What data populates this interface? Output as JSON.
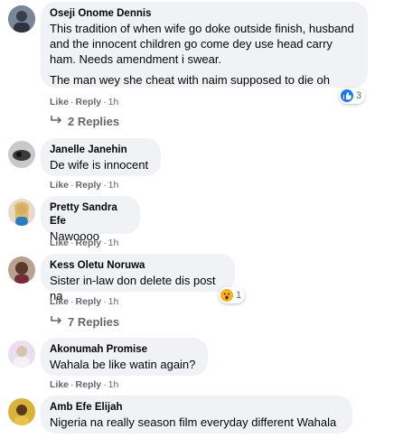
{
  "comments": [
    {
      "name": "Oseji Onome Dennis",
      "text1": "This tradition of when wife go doke outside finish, husband and the innocent children go come dey use head carry ham. Needs amendment i swear.",
      "text2": "The man wey she cheat with naim supposed to die oh",
      "like": "Like",
      "reply": "Reply",
      "time": "1h",
      "reaction_count": "3",
      "reaction_icon": "like-love-icon",
      "replies": "2 Replies"
    },
    {
      "name": "Janelle Janehin",
      "text1": "De wife is innocent",
      "like": "Like",
      "reply": "Reply",
      "time": "1h"
    },
    {
      "name": "Pretty Sandra Efe",
      "text1": "Nawoooo",
      "like": "Like",
      "reply": "Reply",
      "time": "1h"
    },
    {
      "name": "Kess Oletu Noruwa",
      "text1": "Sister in-law don delete dis post na",
      "like": "Like",
      "reply": "Reply",
      "time": "1h",
      "reaction_count": "1",
      "reaction_icon": "wow-icon",
      "replies": "7 Replies"
    },
    {
      "name": "Akonumah Promise",
      "text1": "Wahala be like watin again?",
      "like": "Like",
      "reply": "Reply",
      "time": "1h"
    },
    {
      "name": "Amb Efe Elijah",
      "text1": "Nigeria na really season film everyday different Wahala",
      "like": "Like",
      "reply": "Reply",
      "time": "1h"
    }
  ],
  "colors": {
    "bubble": "#f0f2f5",
    "meta": "#65676b",
    "like_blue": "#1877f2",
    "love_red": "#f33e58",
    "wow_yellow": "#f7b125"
  }
}
